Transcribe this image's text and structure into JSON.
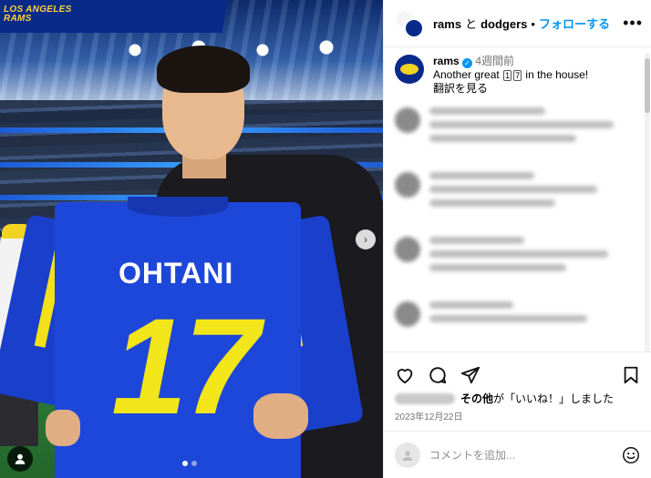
{
  "photo": {
    "banner_text": "LOS ANGELES\nRAMS",
    "jersey_name": "OHTANI",
    "jersey_number": "17",
    "carousel_dots": 2,
    "active_dot": 0
  },
  "header": {
    "account_a": "rams",
    "joiner": "と",
    "account_b": "dodgers",
    "separator": "•",
    "follow_label": "フォローする",
    "more_label": "•••"
  },
  "caption": {
    "username": "rams",
    "time_ago": "4週間前",
    "text_before": "Another great ",
    "emoji_1": "1",
    "emoji_7": "7",
    "text_after": " in the house!",
    "translate_label": "翻訳を見る"
  },
  "likes": {
    "suffix": "その他が「いいね！」しました",
    "bold_part": "その他"
  },
  "date": "2023年12月22日",
  "comment_box": {
    "placeholder": "コメントを追加..."
  },
  "icons": {
    "like": "heart-icon",
    "comment": "comment-icon",
    "share": "share-icon",
    "save": "bookmark-icon",
    "emoji": "emoji-icon"
  },
  "colors": {
    "accent": "#0095f6",
    "rams_blue": "#1d47d8",
    "rams_yellow": "#f2e51a"
  }
}
